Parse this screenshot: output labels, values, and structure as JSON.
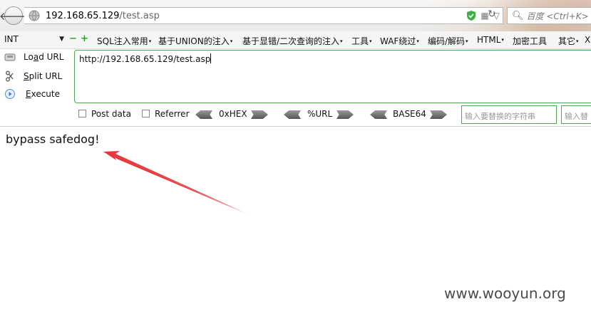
{
  "browser": {
    "url_host": "192.168.65.129",
    "url_path": "/test.asp",
    "search_placeholder": "百度 <Ctrl+K>"
  },
  "hackbar": {
    "int_select": "INT",
    "menu": [
      {
        "label": "SQL注入常用"
      },
      {
        "label": "基于UNION的注入"
      },
      {
        "label": "基于显错/二次查询的注入"
      },
      {
        "label": "工具"
      },
      {
        "label": "WAF绕过"
      },
      {
        "label": "编码/解码"
      },
      {
        "label": "HTML"
      },
      {
        "label": "加密工具"
      },
      {
        "label": "其它"
      },
      {
        "label": "X"
      }
    ],
    "buttons": {
      "load_url_prefix": "Lo",
      "load_url_accel": "a",
      "load_url_suffix": "d URL",
      "split_url_accel": "S",
      "split_url_suffix": "plit URL",
      "execute_accel": "E",
      "execute_suffix": "xecute"
    },
    "url_value": "http://192.168.65.129/test.asp",
    "options": {
      "post_data": "Post data",
      "referrer": "Referrer",
      "hex": "0xHEX",
      "url": "%URL",
      "base64": "BASE64"
    },
    "replace_placeholder_1": "输入要替换的字符串",
    "replace_placeholder_2": "输入替"
  },
  "page": {
    "content_text": "bypass safedog!"
  },
  "watermark": "www.wooyun.org",
  "colors": {
    "hackbar_border": "#55a355",
    "arrow": "#e8383d"
  }
}
